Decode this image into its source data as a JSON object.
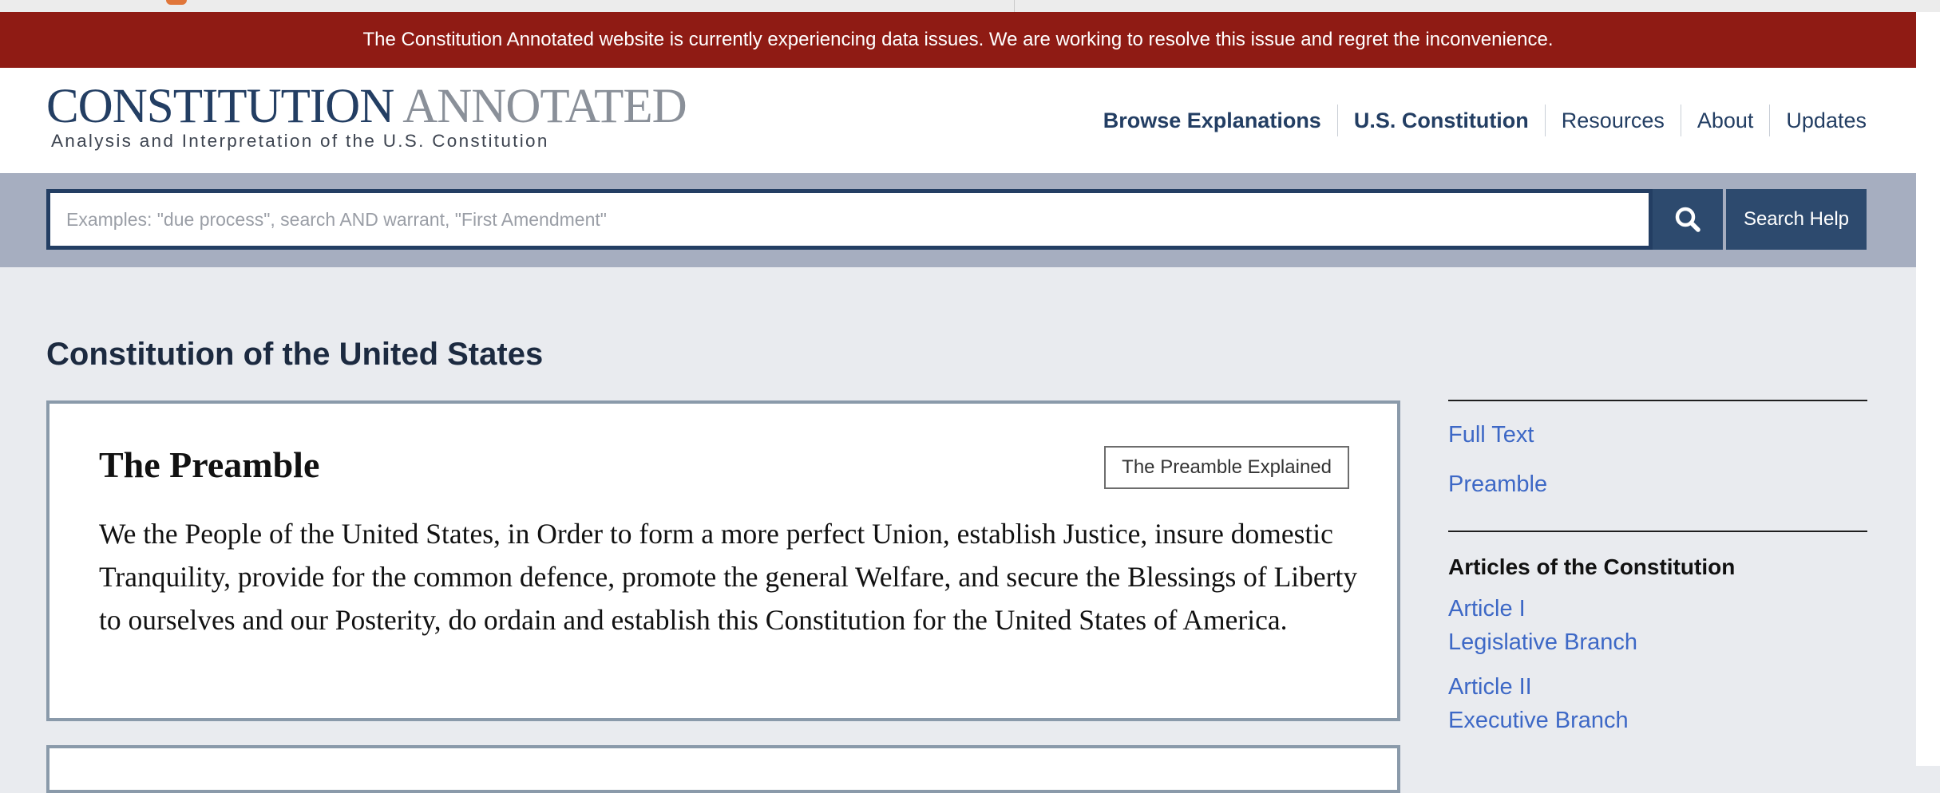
{
  "alert": {
    "message": "The Constitution Annotated website is currently experiencing data issues. We are working to resolve this issue and regret the inconvenience."
  },
  "header": {
    "logo_primary": "CONSTITUTION",
    "logo_secondary": "ANNOTATED",
    "tagline": "Analysis and Interpretation of the U.S. Constitution",
    "nav": [
      {
        "label": "Browse Explanations"
      },
      {
        "label": "U.S. Constitution"
      },
      {
        "label": "Resources"
      },
      {
        "label": "About"
      },
      {
        "label": "Updates"
      }
    ]
  },
  "search": {
    "placeholder": "Examples: \"due process\", search AND warrant, \"First Amendment\"",
    "value": "",
    "submit_icon": "search-icon",
    "help_label": "Search Help"
  },
  "main": {
    "page_title": "Constitution of the United States",
    "card": {
      "heading": "The Preamble",
      "explain_button": "The Preamble Explained",
      "text": "We the People of the United States, in Order to form a more perfect Union, establish Justice, insure domestic Tranquility, provide for the common defence, promote the general Welfare, and secure the Blessings of Liberty to ourselves and our Posterity, do ordain and establish this Constitution for the United States of America."
    }
  },
  "sidebar": {
    "links": [
      {
        "label": "Full Text"
      },
      {
        "label": "Preamble"
      }
    ],
    "articles_heading": "Articles of the Constitution",
    "articles": [
      {
        "label": "Article I",
        "subtitle": "Legislative Branch"
      },
      {
        "label": "Article II",
        "subtitle": "Executive Branch"
      }
    ]
  },
  "colors": {
    "alert_bg": "#8f1b14",
    "brand_navy": "#233e63",
    "logo_gray": "#8a9099",
    "search_band": "#a6aec0",
    "link_blue": "#3d68c6",
    "page_bg": "#e9ebef"
  }
}
